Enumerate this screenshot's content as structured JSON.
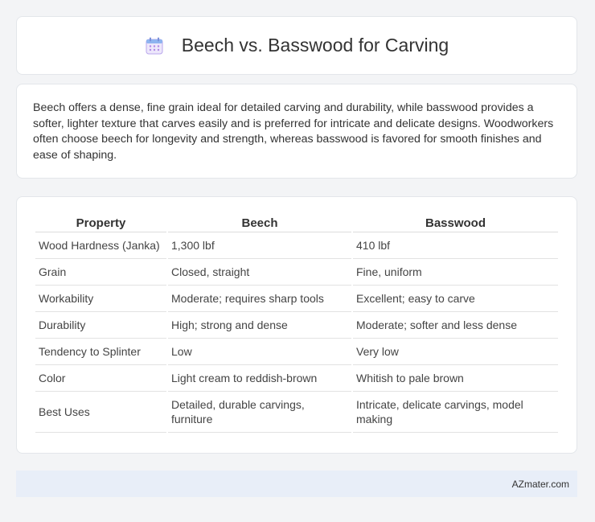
{
  "header": {
    "title": "Beech vs. Basswood for Carving",
    "icon": "calendar-icon"
  },
  "intro": {
    "text": "Beech offers a dense, fine grain ideal for detailed carving and durability, while basswood provides a softer, lighter texture that carves easily and is preferred for intricate and delicate designs. Woodworkers often choose beech for longevity and strength, whereas basswood is favored for smooth finishes and ease of shaping."
  },
  "table": {
    "headers": [
      "Property",
      "Beech",
      "Basswood"
    ],
    "rows": [
      [
        "Wood Hardness (Janka)",
        "1,300 lbf",
        "410 lbf"
      ],
      [
        "Grain",
        "Closed, straight",
        "Fine, uniform"
      ],
      [
        "Workability",
        "Moderate; requires sharp tools",
        "Excellent; easy to carve"
      ],
      [
        "Durability",
        "High; strong and dense",
        "Moderate; softer and less dense"
      ],
      [
        "Tendency to Splinter",
        "Low",
        "Very low"
      ],
      [
        "Color",
        "Light cream to reddish-brown",
        "Whitish to pale brown"
      ],
      [
        "Best Uses",
        "Detailed, durable carvings, furniture",
        "Intricate, delicate carvings, model making"
      ]
    ]
  },
  "footer": {
    "site": "AZmater.com"
  }
}
